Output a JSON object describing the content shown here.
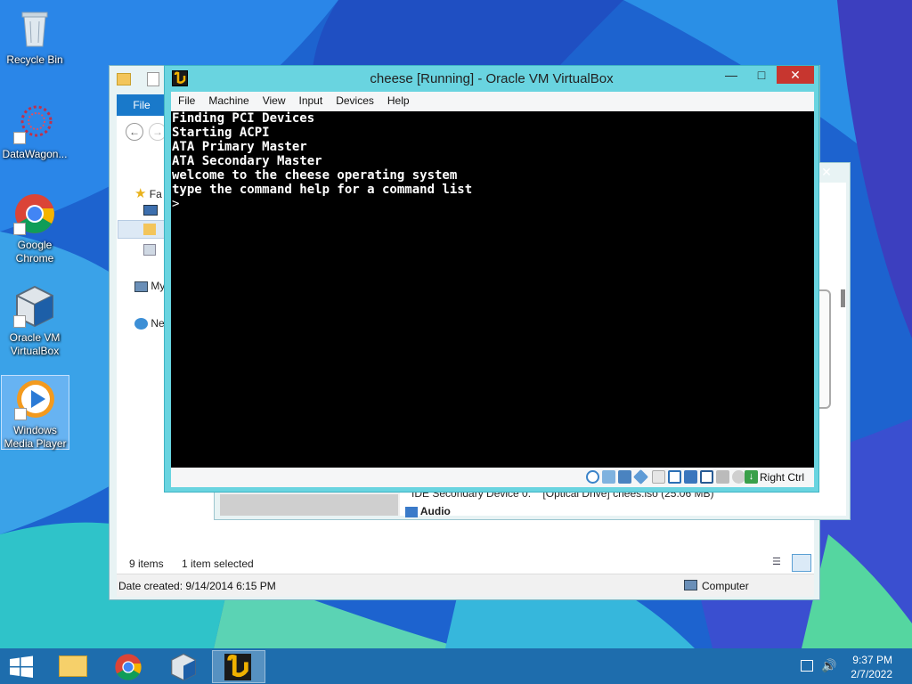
{
  "desktop": {
    "icons": [
      {
        "label": "Recycle Bin",
        "icon": "recycle-bin-icon"
      },
      {
        "label": "DataWagon...",
        "icon": "datawagon-icon"
      },
      {
        "label": "Google Chrome",
        "icon": "chrome-icon"
      },
      {
        "label": "Oracle VM VirtualBox",
        "icon": "virtualbox-icon"
      },
      {
        "label": "Windows Media Player",
        "icon": "media-player-icon"
      }
    ]
  },
  "explorer": {
    "ribbon_file_label": "File",
    "nav": {
      "favorites": "Fa",
      "my": "My",
      "network": "Ne"
    },
    "status": {
      "item_count": "9 items",
      "selected": "1 item selected"
    },
    "details": {
      "date_created": "Date created: 9/14/2014 6:15 PM",
      "location": "Computer"
    }
  },
  "settings_window": {
    "device_label": "IDE Secondary Device 0:",
    "device_value": "[Optical Drive] chees.iso (25.06 MB)",
    "audio_header": "Audio"
  },
  "vm_window": {
    "title": "cheese [Running] - Oracle VM VirtualBox",
    "menu": [
      "File",
      "Machine",
      "View",
      "Input",
      "Devices",
      "Help"
    ],
    "console_lines": [
      "Finding PCI Devices",
      "Starting ACPI",
      "ATA Primary Master",
      "ATA Secondary Master",
      "welcome to the cheese operating system",
      "type the command help for a command list",
      ">"
    ],
    "host_key": "Right Ctrl",
    "status_icons": [
      "optical-drive-icon",
      "audio-icon",
      "network-icon",
      "usb-icon",
      "shared-folder-icon",
      "display-icon",
      "video-capture-icon",
      "hard-disk-icon",
      "cpu-icon",
      "mouse-integration-icon",
      "host-key-icon"
    ]
  },
  "taskbar": {
    "buttons": [
      "start-button",
      "file-explorer-taskbar-button",
      "chrome-taskbar-button",
      "virtualbox-taskbar-button",
      "cheese-vm-taskbar-button"
    ],
    "clock_time": "9:37 PM",
    "clock_date": "2/7/2022"
  },
  "colors": {
    "vm_frame": "#69d4e0",
    "console_bg": "#000000",
    "console_fg": "#ffffff",
    "close_button": "#c7362f",
    "ribbon_file": "#1979ca",
    "taskbar": "#1e6eaa"
  }
}
